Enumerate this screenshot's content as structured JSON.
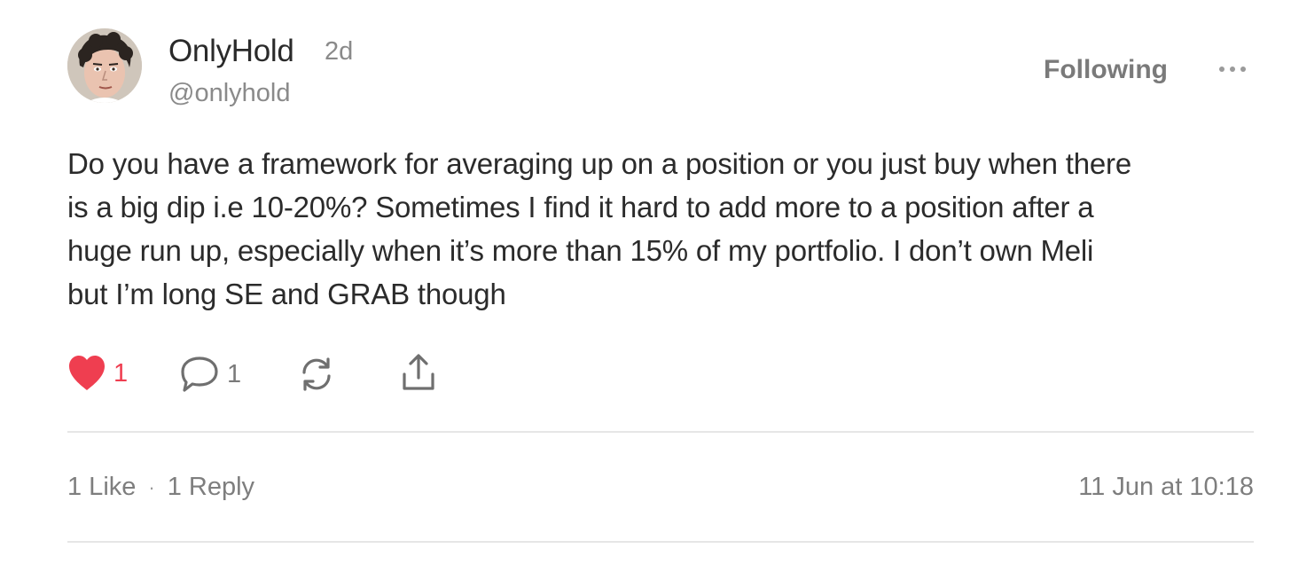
{
  "author": {
    "name": "OnlyHold",
    "age": "2d",
    "handle": "@onlyhold"
  },
  "header": {
    "follow_label": "Following",
    "more_icon": "more-horizontal-icon"
  },
  "post": {
    "lines": [
      "Do you have a framework for averaging up on a position or you just buy when there",
      "is a big dip i.e 10-20%? Sometimes I find it hard to add more to a position after a",
      "huge run up, especially when it’s more than 15% of my portfolio. I don’t own Meli",
      "but I’m long SE and GRAB though"
    ]
  },
  "actions": {
    "like_count": "1",
    "reply_count": "1",
    "like_icon": "heart-icon",
    "reply_icon": "comment-icon",
    "restack_icon": "repost-icon",
    "share_icon": "share-icon"
  },
  "footer": {
    "likes_label": "1 Like",
    "separator": "·",
    "replies_label": "1 Reply",
    "timestamp": "11 Jun at 10:18"
  },
  "colors": {
    "like_red": "#ef3e50",
    "muted_text": "#8a8a8a",
    "divider": "#e6e6e6"
  }
}
